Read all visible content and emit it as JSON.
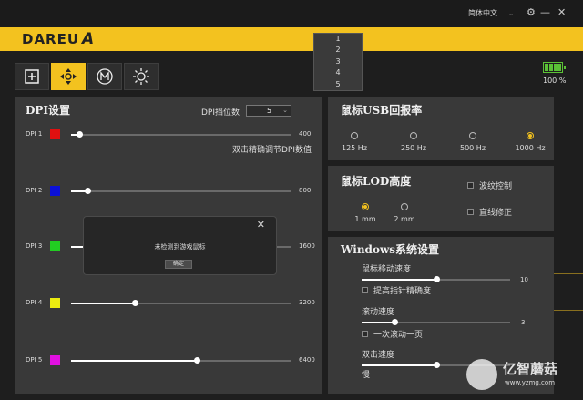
{
  "titlebar": {
    "language": "简体中文",
    "chevron_icon": "chevron-down",
    "settings_icon": "gear",
    "minimize_icon": "minus",
    "close_icon": "close"
  },
  "brand": {
    "logo_text": "DAREU",
    "logo_mark": "A"
  },
  "dpi_dropdown_options": [
    "1",
    "2",
    "3",
    "4",
    "5"
  ],
  "mode_buttons": [
    {
      "id": "macro",
      "icon": "plus-square"
    },
    {
      "id": "move",
      "icon": "direction-pad",
      "active": true
    },
    {
      "id": "m",
      "icon": "circle-m"
    },
    {
      "id": "light",
      "icon": "sun"
    }
  ],
  "battery": {
    "percent_text": "100 %",
    "level": 1.0,
    "color": "#5bc236"
  },
  "accent_color": "#f3c21f",
  "dpi_panel": {
    "title": "DPI设置",
    "level_label": "DPI挡位数",
    "level_value": "5",
    "hint": "双击精确调节DPI数值",
    "rows": [
      {
        "label": "DPI 1",
        "color": "#e01010",
        "value": "400",
        "fraction": 0.037
      },
      {
        "label": "DPI 2",
        "color": "#0b10d8",
        "value": "800",
        "fraction": 0.075
      },
      {
        "label": "DPI 3",
        "color": "#22cc22",
        "value": "1600",
        "fraction": 0.15
      },
      {
        "label": "DPI 4",
        "color": "#ecec10",
        "value": "3200",
        "fraction": 0.29
      },
      {
        "label": "DPI 5",
        "color": "#e010e0",
        "value": "6400",
        "fraction": 0.57
      }
    ]
  },
  "report_rate": {
    "title": "鼠标USB回报率",
    "options": [
      {
        "label": "125 Hz",
        "selected": false
      },
      {
        "label": "250 Hz",
        "selected": false
      },
      {
        "label": "500 Hz",
        "selected": false
      },
      {
        "label": "1000 Hz",
        "selected": true
      }
    ]
  },
  "lod": {
    "title": "鼠标LOD高度",
    "options": [
      {
        "label": "1 mm",
        "selected": true
      },
      {
        "label": "2 mm",
        "selected": false
      }
    ],
    "checks": [
      {
        "label": "波纹控制",
        "checked": false
      },
      {
        "label": "直线修正",
        "checked": false
      }
    ]
  },
  "windows": {
    "title": "Windows系统设置",
    "mouse_speed_label": "鼠标移动速度",
    "mouse_speed_value": "10",
    "mouse_speed_fraction": 0.5,
    "precision_label": "提高指针精确度",
    "scroll_speed_label": "滚动速度",
    "scroll_speed_value": "3",
    "scroll_speed_fraction": 0.22,
    "scroll_page_label": "一次滚动一页",
    "double_click_label": "双击速度",
    "double_click_slow": "慢",
    "double_click_fraction": 0.5
  },
  "dialog": {
    "message": "未检测到游戏鼠标",
    "ok_label": "确定",
    "close_icon": "close"
  },
  "watermark": {
    "text": "亿智蘑菇",
    "url": "www.yzmg.com"
  }
}
